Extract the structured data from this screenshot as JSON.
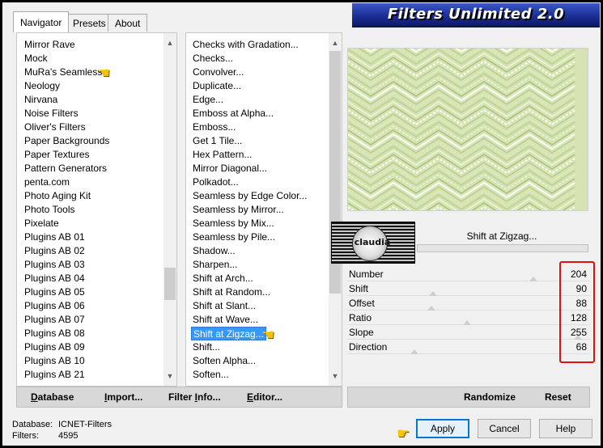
{
  "window": {
    "title": "Filters Unlimited 2.0",
    "tabs": [
      {
        "label": "Navigator",
        "active": true
      },
      {
        "label": "Presets",
        "active": false
      },
      {
        "label": "About",
        "active": false
      }
    ]
  },
  "categories": {
    "items": [
      "Mirror Rave",
      "Mock",
      "MuRa's Seamless",
      "Neology",
      "Nirvana",
      "Noise Filters",
      "Oliver's Filters",
      "Paper Backgrounds",
      "Paper Textures",
      "Pattern Generators",
      "penta.com",
      "Photo Aging Kit",
      "Photo Tools",
      "Pixelate",
      "Plugins AB 01",
      "Plugins AB 02",
      "Plugins AB 03",
      "Plugins AB 04",
      "Plugins AB 05",
      "Plugins AB 06",
      "Plugins AB 07",
      "Plugins AB 08",
      "Plugins AB 09",
      "Plugins AB 10",
      "Plugins AB 21"
    ],
    "highlighted": "MuRa's Seamless"
  },
  "filters": {
    "items": [
      "Checks with Gradation...",
      "Checks...",
      "Convolver...",
      "Duplicate...",
      "Edge...",
      "Emboss at Alpha...",
      "Emboss...",
      "Get 1 Tile...",
      "Hex Pattern...",
      "Mirror Diagonal...",
      "Polkadot...",
      "Seamless by Edge Color...",
      "Seamless by Mirror...",
      "Seamless by Mix...",
      "Seamless by Pile...",
      "Shadow...",
      "Sharpen...",
      "Shift at Arch...",
      "Shift at Random...",
      "Shift at Slant...",
      "Shift at Wave...",
      "Shift at Zigzag...",
      "Shift...",
      "Soften Alpha...",
      "Soften..."
    ],
    "selected": "Shift at Zigzag..."
  },
  "preview": {
    "watermark_text": "claudia",
    "filter_name": "Shift at Zigzag..."
  },
  "params": [
    {
      "label": "Number",
      "value": "204",
      "level": 204
    },
    {
      "label": "Shift",
      "value": "90",
      "level": 90
    },
    {
      "label": "Offset",
      "value": "88",
      "level": 88
    },
    {
      "label": "Ratio",
      "value": "128",
      "level": 128
    },
    {
      "label": "Slope",
      "value": "255",
      "level": 255
    },
    {
      "label": "Direction",
      "value": "68",
      "level": 68
    }
  ],
  "toolbar": {
    "database": {
      "pre": "",
      "ul": "D",
      "post": "atabase"
    },
    "import": {
      "pre": "",
      "ul": "I",
      "post": "mport..."
    },
    "filter_info": {
      "pre": "Filter ",
      "ul": "I",
      "post": "nfo..."
    },
    "editor": {
      "pre": "",
      "ul": "E",
      "post": "ditor..."
    },
    "randomize": "Randomize",
    "reset": "Reset"
  },
  "status": {
    "database_label": "Database:",
    "database_value": "ICNET-Filters",
    "filters_label": "Filters:",
    "filters_value": "4595"
  },
  "buttons": {
    "apply": "Apply",
    "cancel": "Cancel",
    "help": "Help"
  },
  "colors": {
    "selection": "#3399ff",
    "banner": "#1c2f96",
    "highlight_box": "#e01010",
    "preview_bg": "#d6e4b4"
  }
}
